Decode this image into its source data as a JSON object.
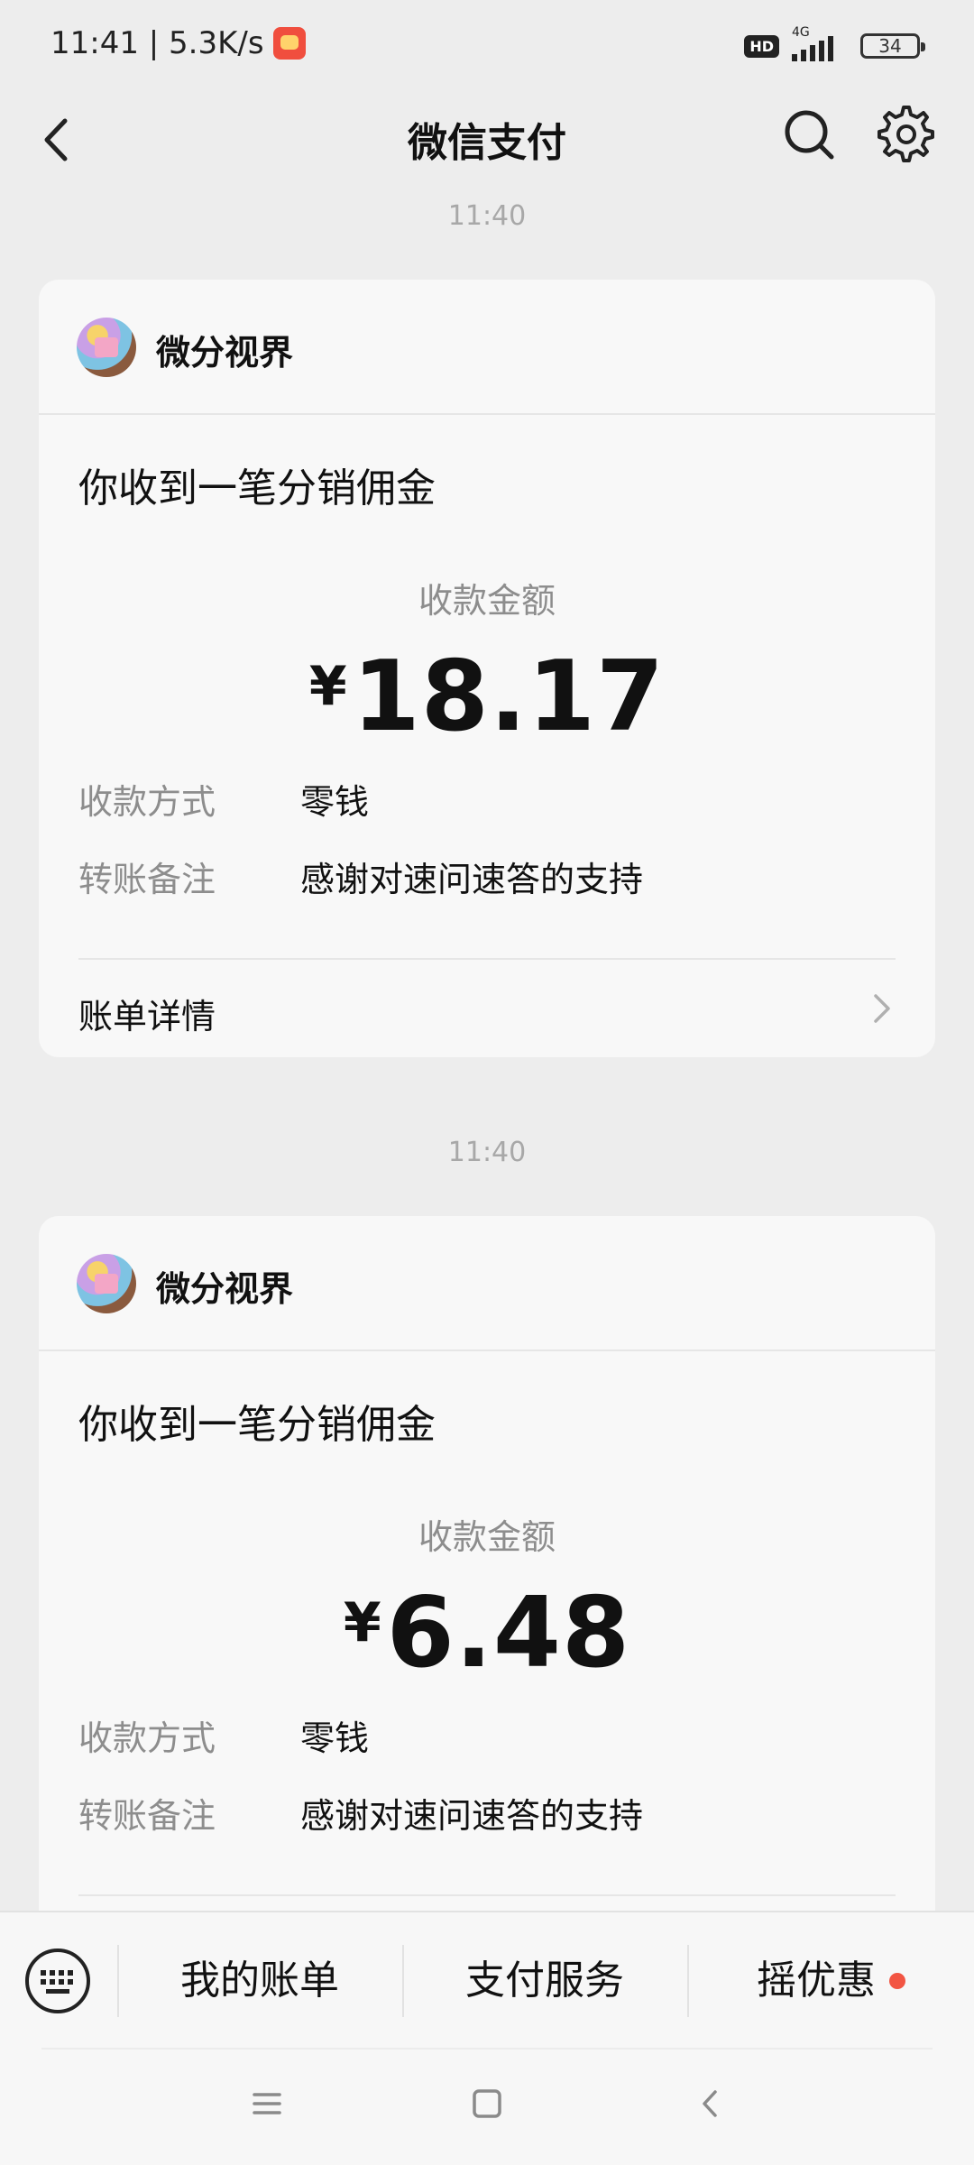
{
  "status_bar": {
    "time_speed": "11:41 | 5.3K/s",
    "hd": "HD",
    "network": "4G",
    "battery": "34"
  },
  "nav": {
    "title": "微信支付"
  },
  "messages": [
    {
      "timestamp": "11:40",
      "brand": "微分视界",
      "title": "你收到一笔分销佣金",
      "amount_label": "收款金额",
      "currency": "¥",
      "amount": "18.17",
      "rows": [
        {
          "key": "收款方式",
          "value": "零钱"
        },
        {
          "key": "转账备注",
          "value": "感谢对速问速答的支持"
        }
      ],
      "footer": "账单详情"
    },
    {
      "timestamp": "11:40",
      "brand": "微分视界",
      "title": "你收到一笔分销佣金",
      "amount_label": "收款金额",
      "currency": "¥",
      "amount": "6.48",
      "rows": [
        {
          "key": "收款方式",
          "value": "零钱"
        },
        {
          "key": "转账备注",
          "value": "感谢对速问速答的支持"
        }
      ]
    }
  ],
  "menu": {
    "items": [
      "我的账单",
      "支付服务",
      "摇优惠"
    ]
  },
  "colors": {
    "accent_dot": "#f25543",
    "background": "#ededed",
    "card": "#f8f8f8"
  },
  "icons": [
    "back-arrow-icon",
    "search-icon",
    "gear-icon",
    "chevron-right-icon",
    "keyboard-icon",
    "menu-lines-icon",
    "home-square-icon",
    "back-chevron-icon"
  ]
}
